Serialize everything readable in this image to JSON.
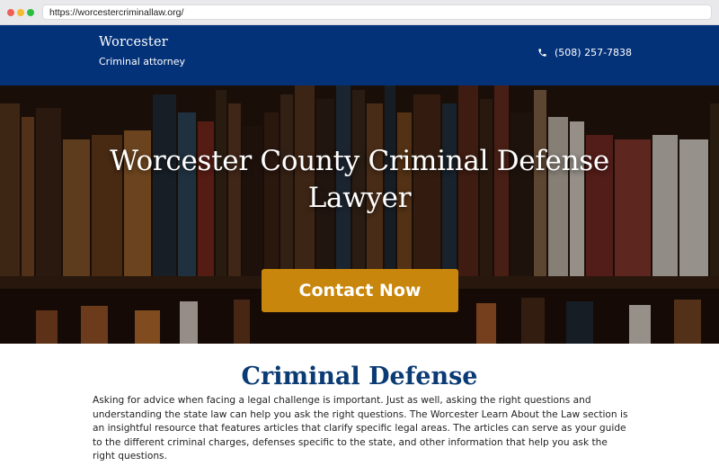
{
  "browser": {
    "url": "https://worcestercriminallaw.org/"
  },
  "header": {
    "brand_name": "Worcester",
    "brand_subtitle": "Criminal attorney",
    "phone": "(508) 257-7838",
    "bg_color": "#043279"
  },
  "hero": {
    "title": "Worcester County Criminal Defense Lawyer",
    "cta_label": "Contact Now",
    "cta_color": "#c9860c"
  },
  "content": {
    "title": "Criminal Defense",
    "body": "Asking for advice when facing a legal challenge is important. Just as well, asking the right questions and understanding the state law can help you ask the right questions. The Worcester Learn About the Law section is an insightful resource that features articles that clarify specific legal areas. The articles can serve as your guide to the different criminal charges, defenses specific to the state, and other information that help you ask the right questions.",
    "title_color": "#0b3b74"
  },
  "icons": {
    "phone": "phone-icon"
  }
}
